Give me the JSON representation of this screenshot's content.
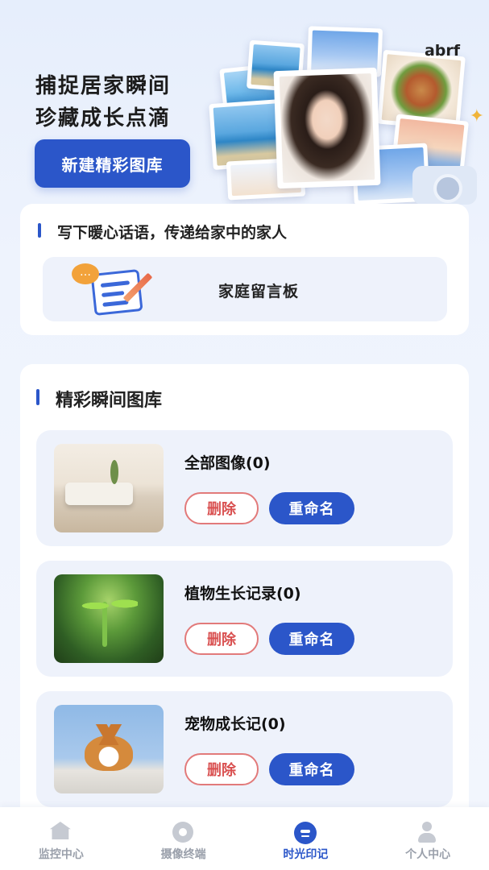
{
  "hero": {
    "title_line1": "捕捉居家瞬间",
    "title_line2": "珍藏成长点滴",
    "new_gallery_button": "新建精彩图库",
    "watermark": "abrf"
  },
  "message_section": {
    "title": "写下暖心话语，传递给家中的家人",
    "board_label": "家庭留言板"
  },
  "gallery_section": {
    "title": "精彩瞬间图库",
    "albums": [
      {
        "name": "全部图像(0)",
        "delete_label": "删除",
        "rename_label": "重命名",
        "thumbnail": "living-room-photo"
      },
      {
        "name": "植物生长记录(0)",
        "delete_label": "删除",
        "rename_label": "重命名",
        "thumbnail": "plant-sprout-photo"
      },
      {
        "name": "宠物成长记(0)",
        "delete_label": "删除",
        "rename_label": "重命名",
        "thumbnail": "corgi-puppy-photo"
      }
    ]
  },
  "tabbar": {
    "tabs": [
      {
        "label": "监控中心",
        "icon": "home-icon",
        "active": false
      },
      {
        "label": "摄像终端",
        "icon": "camera-icon",
        "active": false
      },
      {
        "label": "时光印记",
        "icon": "smile-face-icon",
        "active": true
      },
      {
        "label": "个人中心",
        "icon": "user-icon",
        "active": false
      }
    ]
  },
  "colors": {
    "accent": "#2b56c9",
    "delete": "#d95151",
    "panel": "#eef2fb"
  }
}
